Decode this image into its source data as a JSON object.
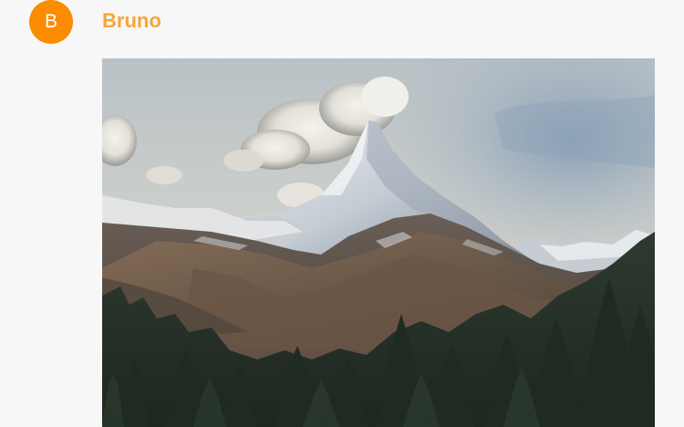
{
  "message": {
    "author_name": "Bruno",
    "avatar_initial": "B",
    "avatar_color": "#fb8c00",
    "author_color": "#f8a53a"
  },
  "attachment": {
    "type": "image",
    "subject": "mountain-landscape"
  }
}
